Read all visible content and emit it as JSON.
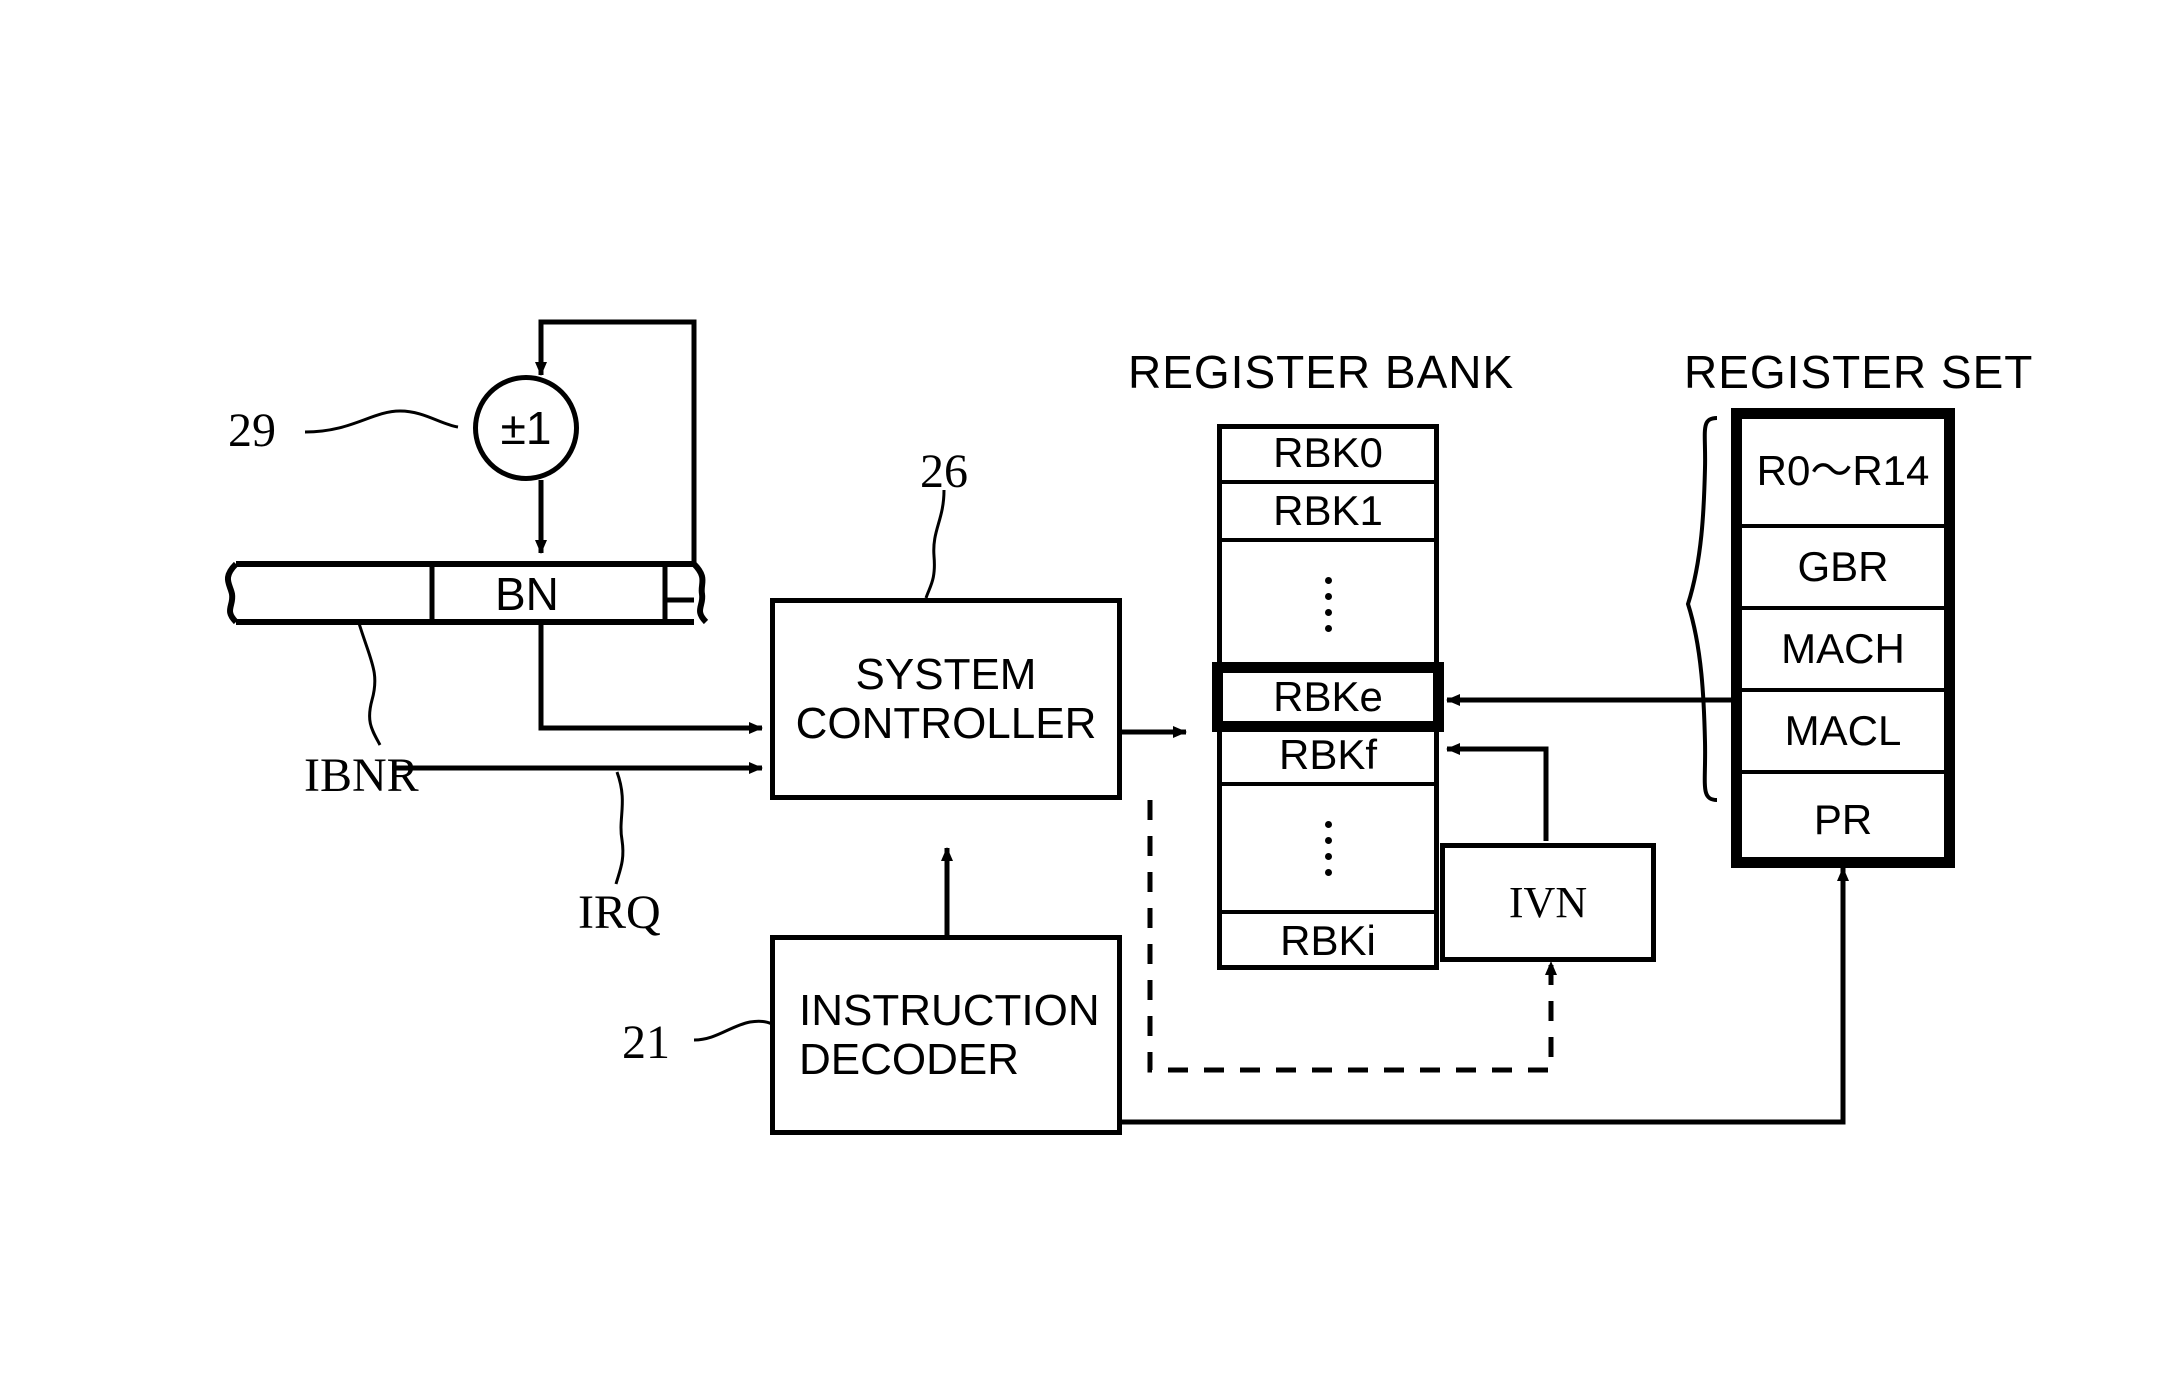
{
  "figure": {
    "headings": {
      "register_bank": "REGISTER BANK",
      "register_set": "REGISTER SET"
    },
    "reference_numerals": {
      "incrementer": "29",
      "system_controller": "26",
      "instruction_decoder": "21"
    },
    "blocks": {
      "incrementer": "±1",
      "bn_field": "BN",
      "ibnr_label": "IBNR",
      "irq_label": "IRQ",
      "system_controller_line1": "SYSTEM",
      "system_controller_line2": "CONTROLLER",
      "instruction_decoder_line1": "INSTRUCTION",
      "instruction_decoder_line2": "DECODER",
      "ivn": "IVN"
    },
    "register_bank_rows": [
      {
        "label": "RBK0",
        "kind": "text",
        "highlight": false
      },
      {
        "label": "RBK1",
        "kind": "text",
        "highlight": false
      },
      {
        "label": "",
        "kind": "dots",
        "highlight": false
      },
      {
        "label": "RBKe",
        "kind": "text",
        "highlight": true
      },
      {
        "label": "RBKf",
        "kind": "text",
        "highlight": false
      },
      {
        "label": "",
        "kind": "dots",
        "highlight": false
      },
      {
        "label": "RBKi",
        "kind": "text",
        "highlight": false
      }
    ],
    "register_set_rows": [
      {
        "label": "R0～R14"
      },
      {
        "label": "GBR"
      },
      {
        "label": "MACH"
      },
      {
        "label": "MACL"
      },
      {
        "label": "PR"
      }
    ],
    "colors": {
      "ink": "#000000",
      "paper": "#ffffff"
    }
  }
}
